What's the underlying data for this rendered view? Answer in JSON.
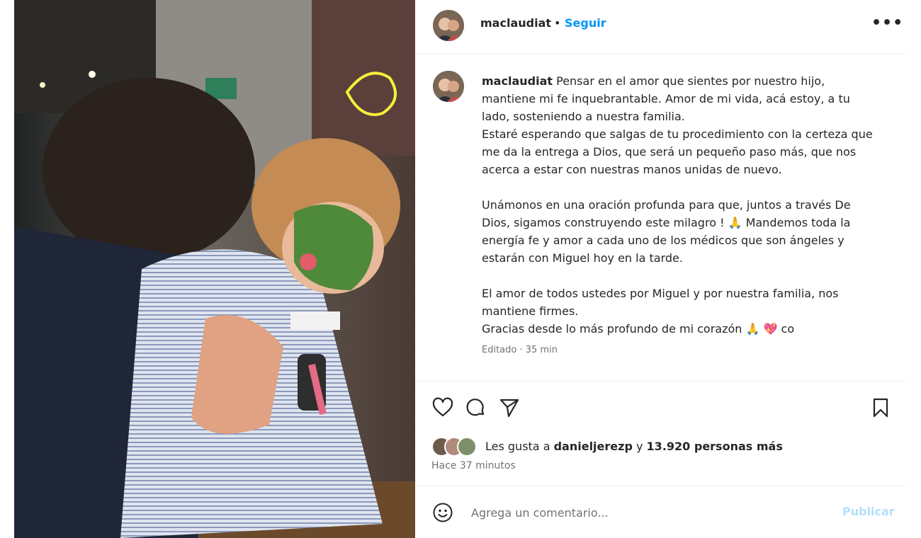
{
  "post": {
    "username": "maclaudiat",
    "separator": "•",
    "follow_label": "Seguir",
    "more_label": "•••",
    "caption_username": "maclaudiat",
    "caption_paragraphs": [
      "Pensar en el amor que sientes por nuestro hijo, mantiene mi fe inquebrantable. Amor de mi vida, acá estoy, a tu lado, sosteniendo a nuestra familia.",
      "Estaré esperando que salgas de tu procedimiento con la certeza que me da la entrega a Dios, que será un pequeño paso más, que nos acerca a estar con nuestras manos unidas de nuevo.",
      "Unámonos en una oración profunda para que, juntos a través De Dios, sigamos construyendo este milagro ! 🙏 Mandemos toda la energía fe y amor a cada uno de los médicos que son ángeles y estarán con Miguel hoy en la tarde.",
      "El amor de todos ustedes por Miguel y por nuestra familia, nos mantiene firmes.",
      "Gracias desde lo más profundo de mi corazón 🙏 💖 co"
    ],
    "edited_label": "Editado · 35 min",
    "likes": {
      "prefix": "Les gusta a ",
      "user": "danieljerezp",
      "middle": " y ",
      "count_text": "13.920 personas más"
    },
    "timestamp": "Hace 37 minutos",
    "comment_placeholder": "Agrega un comentario...",
    "publish_label": "Publicar"
  },
  "icons": {
    "like": "heart-icon",
    "comment": "comment-icon",
    "share": "send-icon",
    "save": "bookmark-icon",
    "emoji": "smiley-icon"
  },
  "colors": {
    "link_blue": "#0095f6",
    "publish_disabled": "#b2dffc",
    "secondary_text": "#737373",
    "divider": "#efefef"
  }
}
